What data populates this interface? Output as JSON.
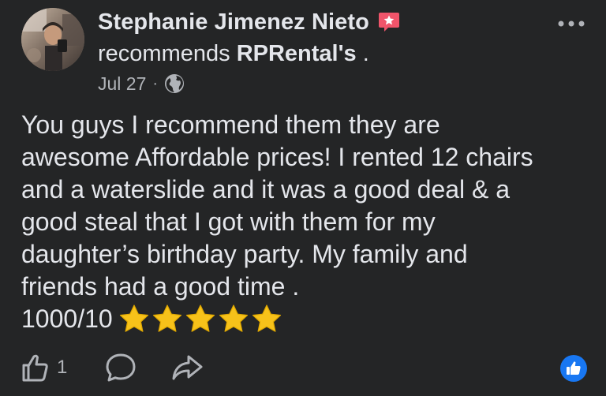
{
  "post": {
    "author": "Stephanie Jimenez Nieto",
    "action_prefix": "recommends",
    "page_name": "RPRental's",
    "action_suffix": " .",
    "date": "Jul 27",
    "separator": "·",
    "privacy_icon": "globe-icon",
    "badge_icon": "star-badge-icon",
    "more_icon": "more-dots-icon",
    "body": "You guys I recommend them they are\nawesome Affordable prices! I rented 12 chairs\nand a waterslide and it was a good deal & a\ngood steal that I got with them for my\ndaughter’s birthday party. My family and\nfriends had a good time .",
    "rating_text": "1000/10",
    "stars": 5
  },
  "actions": {
    "like_icon": "thumbs-up-icon",
    "like_count": "1",
    "comment_icon": "comment-icon",
    "share_icon": "share-icon",
    "reaction_icon": "like-reaction-icon"
  },
  "colors": {
    "background": "#242526",
    "text_primary": "#e4e6eb",
    "text_secondary": "#b0b3b8",
    "badge_pink": "#f0546a",
    "reaction_blue": "#1877f2",
    "star_gold": "#f7c21a"
  }
}
